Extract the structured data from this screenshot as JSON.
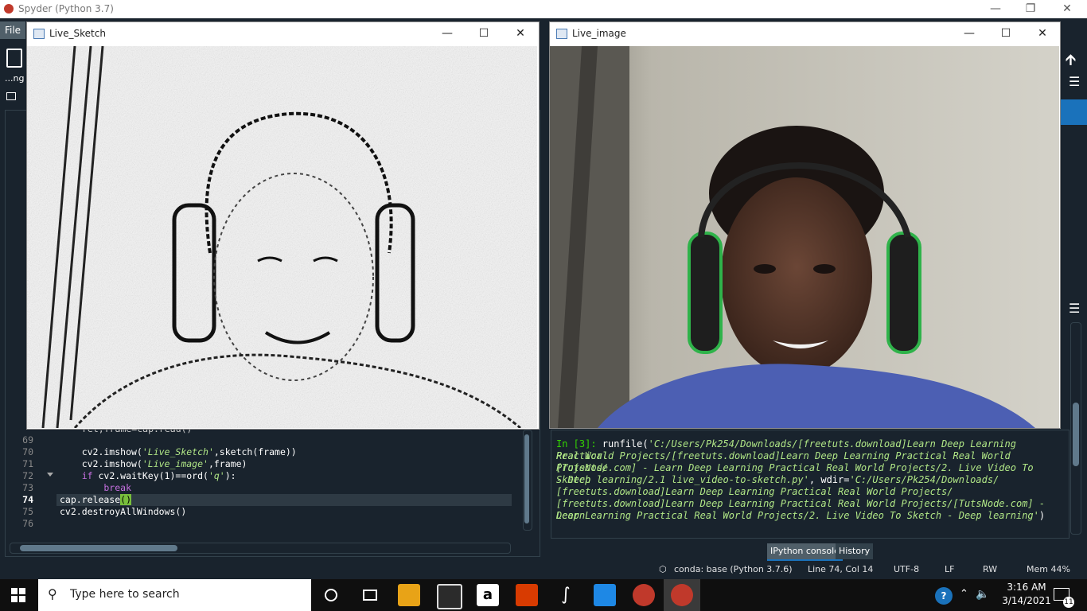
{
  "spyder": {
    "title": "Spyder (Python 3.7)",
    "menu_file": "File",
    "left_tab_label": "...ng"
  },
  "live_sketch_window": {
    "title": "Live_Sketch"
  },
  "live_image_window": {
    "title": "Live_image"
  },
  "editor": {
    "partial_line": "ret,frame=cap.read()",
    "line_numbers": [
      "69",
      "70",
      "71",
      "72",
      "73",
      "74",
      "75",
      "76"
    ],
    "line70_a": "    cv2.imshow(",
    "line70_str": "'Live_Sketch'",
    "line70_b": ",sketch(frame))",
    "line71_a": "    cv2.imshow(",
    "line71_str": "'Live_image'",
    "line71_b": ",frame)",
    "line72_kw": "    if",
    "line72_a": " cv2.waitKey(1)==ord(",
    "line72_str": "'q'",
    "line72_b": "):",
    "line73_kw": "        break",
    "line74_a": "cap.release",
    "line74_paren": "()",
    "line75": "cv2.destroyAllWindows()"
  },
  "console": {
    "prompt": "In [3]:",
    "cmd": " runfile(",
    "path_line1": "'C:/Users/Pk254/Downloads/[freetuts.download]Learn Deep Learning Practical",
    "path_line2": "Real World Projects/[freetuts.download]Learn Deep Learning Practical Real World Projects/",
    "path_line3": "[TutsNode.com] - Learn Deep Learning Practical Real World Projects/2. Live Video To Sketch",
    "path_line4a": "- Deep learning/2.1 live_video-to-sketch.py'",
    "path_line4b": ", wdir=",
    "path_line4c": "'C:/Users/Pk254/Downloads/",
    "path_line5": "[freetuts.download]Learn Deep Learning Practical Real World Projects/",
    "path_line6": "[freetuts.download]Learn Deep Learning Practical Real World Projects/[TutsNode.com] - Learn",
    "path_line7a": "Deep Learning Practical Real World Projects/2. Live Video To Sketch - Deep learning'",
    "path_line7b": ")",
    "tab_ipython": "IPython console",
    "tab_history": "History"
  },
  "status_bar": {
    "conda": "conda: base (Python 3.7.6)",
    "position": "Line 74, Col 14",
    "encoding": "UTF-8",
    "eol": "LF",
    "rw": "RW",
    "mem": "Mem 44%"
  },
  "taskbar": {
    "search_placeholder": "Type here to search",
    "time": "3:16 AM",
    "date": "3/14/2021",
    "notification_count": "11"
  }
}
